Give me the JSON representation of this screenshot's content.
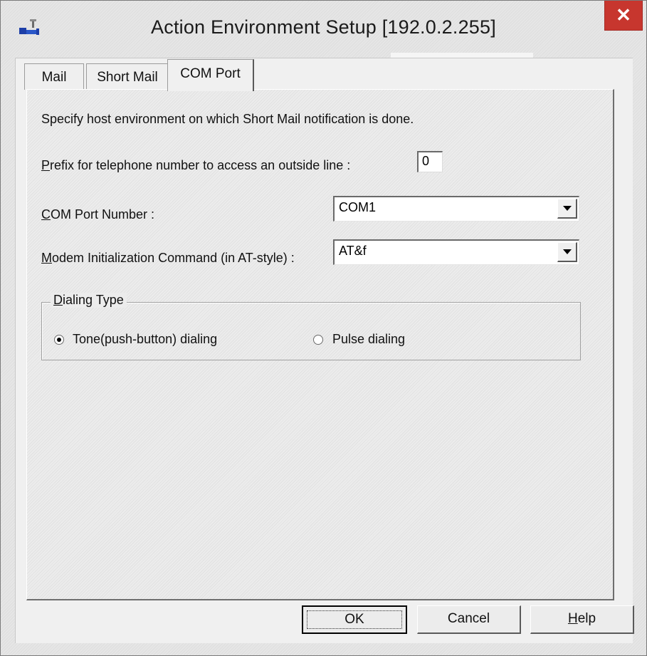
{
  "window": {
    "title": "Action Environment Setup [192.0.2.255]",
    "close_glyph": "✕",
    "app_icon": "setup-wrench-icon"
  },
  "tabs": [
    {
      "label": "Mail",
      "active": false
    },
    {
      "label": "Short Mail",
      "active": false
    },
    {
      "label": "COM Port",
      "active": true
    }
  ],
  "content": {
    "description": "Specify host environment on which Short Mail notification is done.",
    "prefix": {
      "mnemonic": "P",
      "label_rest": "refix for telephone number to access an outside line :",
      "value": "0"
    },
    "com_port": {
      "mnemonic": "C",
      "label_rest": "OM Port Number :",
      "value": "COM1"
    },
    "modem": {
      "mnemonic": "M",
      "label_rest": "odem Initialization Command (in AT-style) :",
      "value": "AT&f"
    },
    "dialing": {
      "mnemonic": "D",
      "title_rest": "ialing Type",
      "options": [
        {
          "label": "Tone(push-button) dialing",
          "checked": true
        },
        {
          "label": "Pulse dialing",
          "checked": false
        }
      ]
    }
  },
  "buttons": {
    "ok": "OK",
    "cancel": "Cancel",
    "help_mnemonic": "H",
    "help_rest": "elp"
  }
}
